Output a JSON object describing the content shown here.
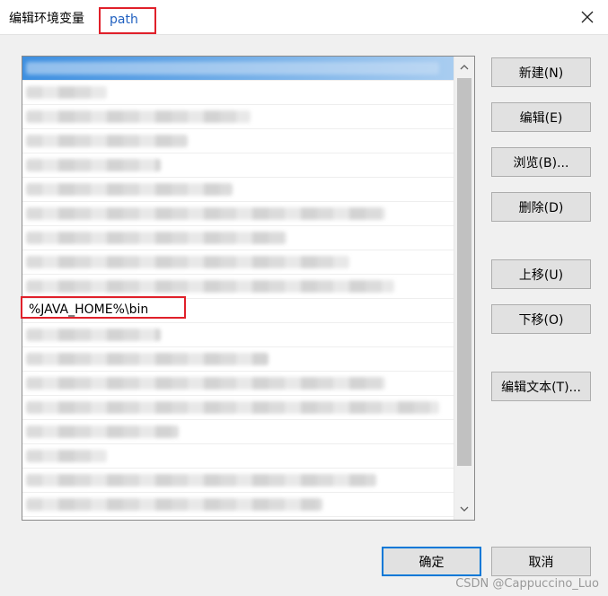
{
  "dialog": {
    "title": "编辑环境变量",
    "variable_name": "path"
  },
  "list": {
    "visible_entry": "%JAVA_HOME%\\bin"
  },
  "buttons": {
    "new": "新建(N)",
    "edit": "编辑(E)",
    "browse": "浏览(B)...",
    "delete": "删除(D)",
    "move_up": "上移(U)",
    "move_down": "下移(O)",
    "edit_text": "编辑文本(T)...",
    "ok": "确定",
    "cancel": "取消"
  },
  "watermark": "CSDN @Cappuccino_Luo",
  "colors": {
    "highlight_border": "#e0202a",
    "selection": "#3d8fe0",
    "primary_border": "#0078d7"
  }
}
